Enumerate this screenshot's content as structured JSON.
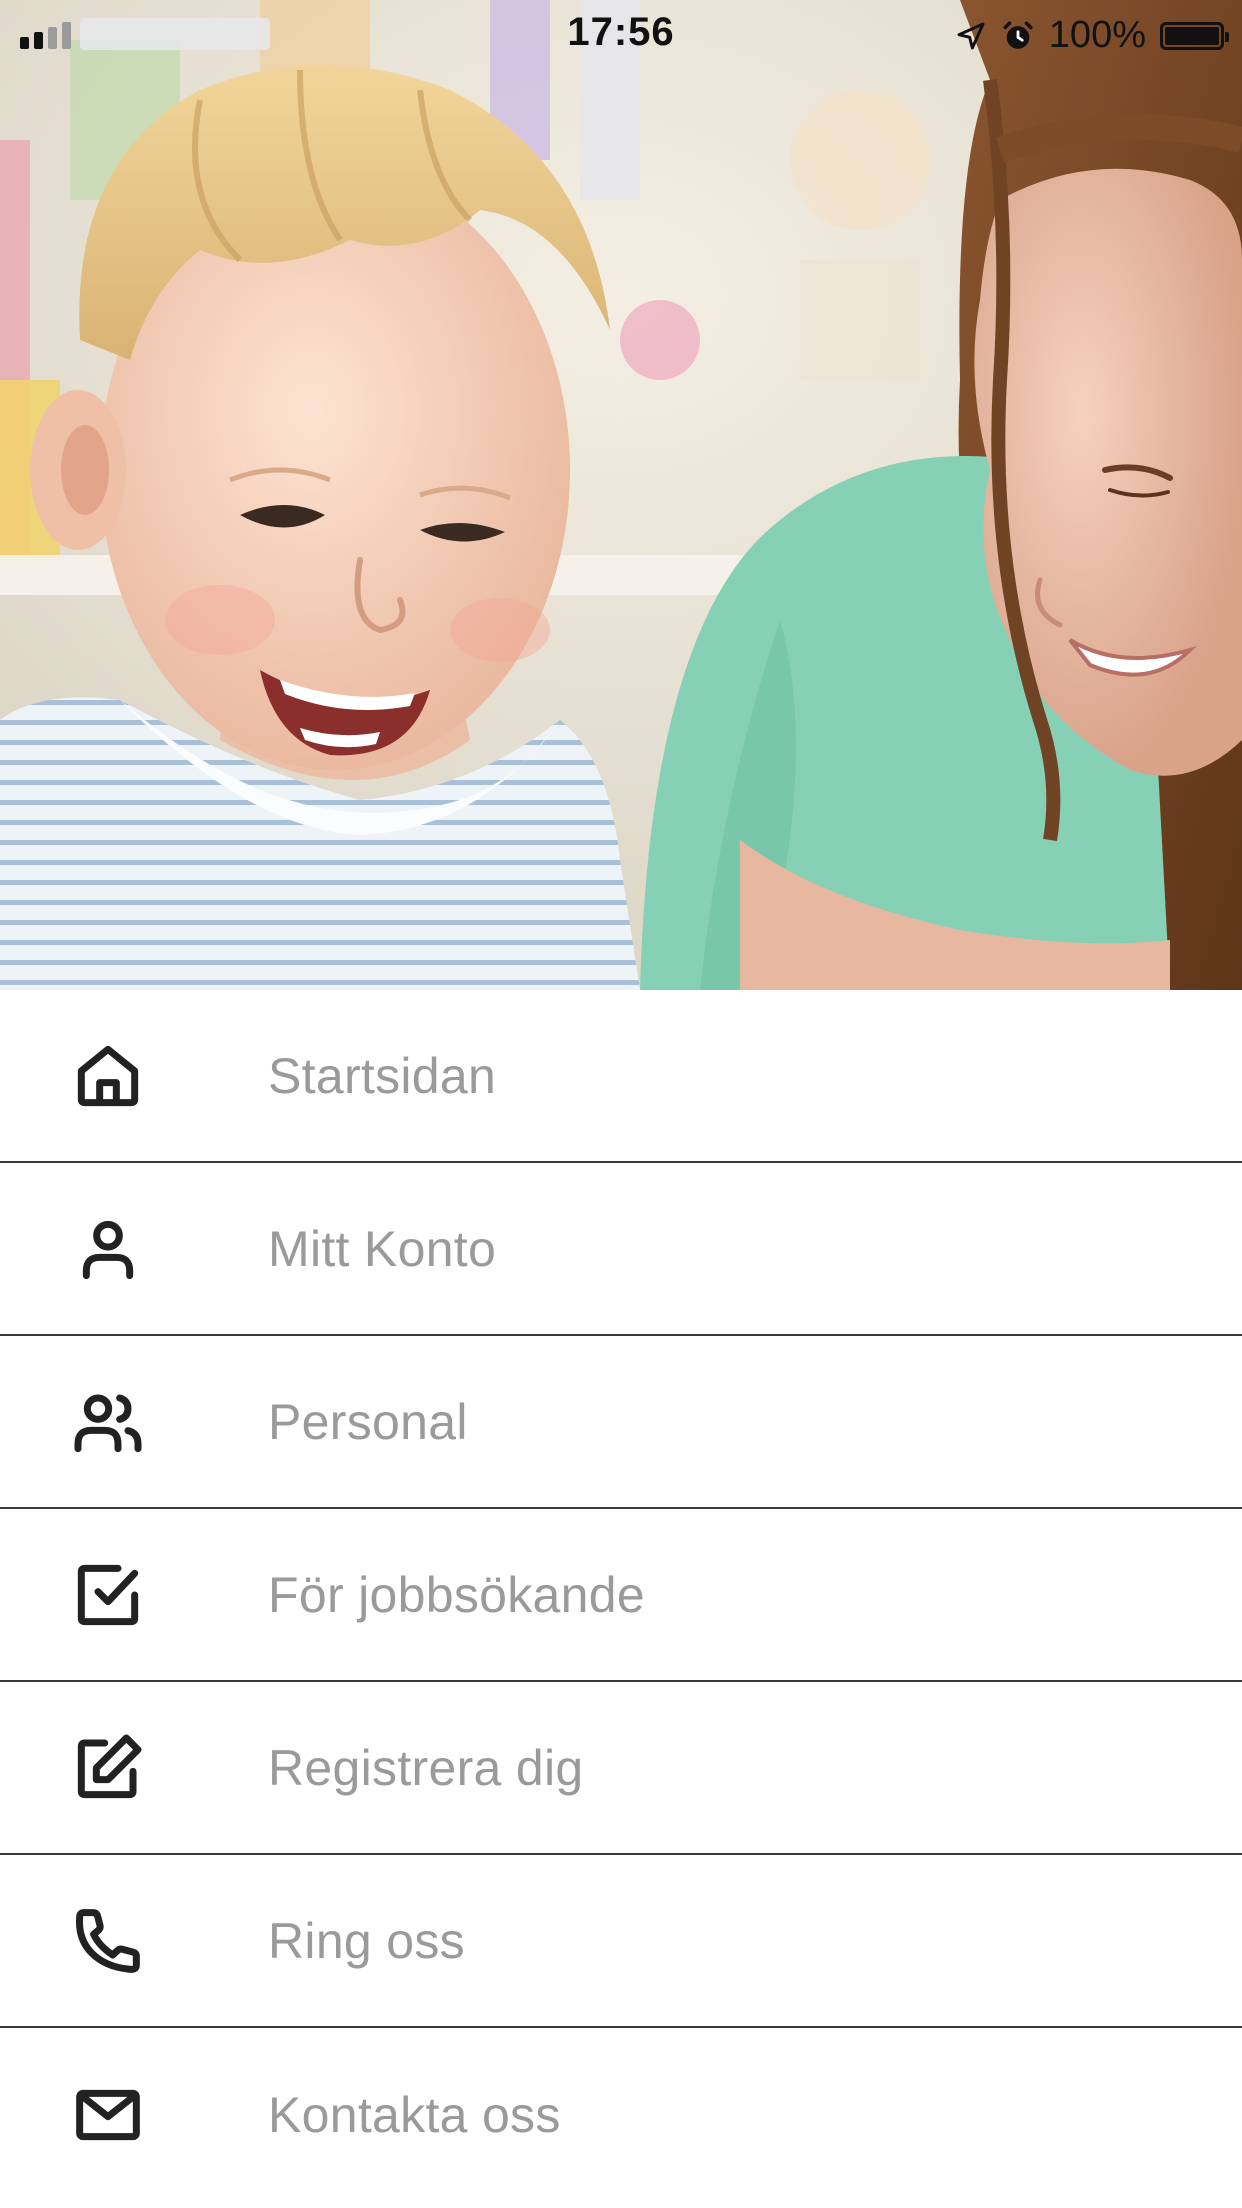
{
  "status_bar": {
    "time": "17:56",
    "battery_percent": "100%",
    "signal_bars_active": 2,
    "icons": [
      "signal-icon",
      "location-arrow-icon",
      "alarm-icon",
      "battery-icon"
    ]
  },
  "hero": {
    "image": "photo of a laughing toddler and a smiling woman in a nursery"
  },
  "menu": {
    "items": [
      {
        "label": "Startsidan",
        "icon": "home-icon"
      },
      {
        "label": "Mitt Konto",
        "icon": "user-icon"
      },
      {
        "label": "Personal",
        "icon": "users-icon"
      },
      {
        "label": "För jobbsökande",
        "icon": "checkbox-icon"
      },
      {
        "label": "Registrera dig",
        "icon": "edit-icon"
      },
      {
        "label": "Ring oss",
        "icon": "phone-icon"
      },
      {
        "label": "Kontakta oss",
        "icon": "mail-icon"
      }
    ]
  },
  "colors": {
    "menu_label": "#9a9a9a",
    "menu_icon": "#222222",
    "divider": "#3a3a3a",
    "background": "#ffffff"
  }
}
